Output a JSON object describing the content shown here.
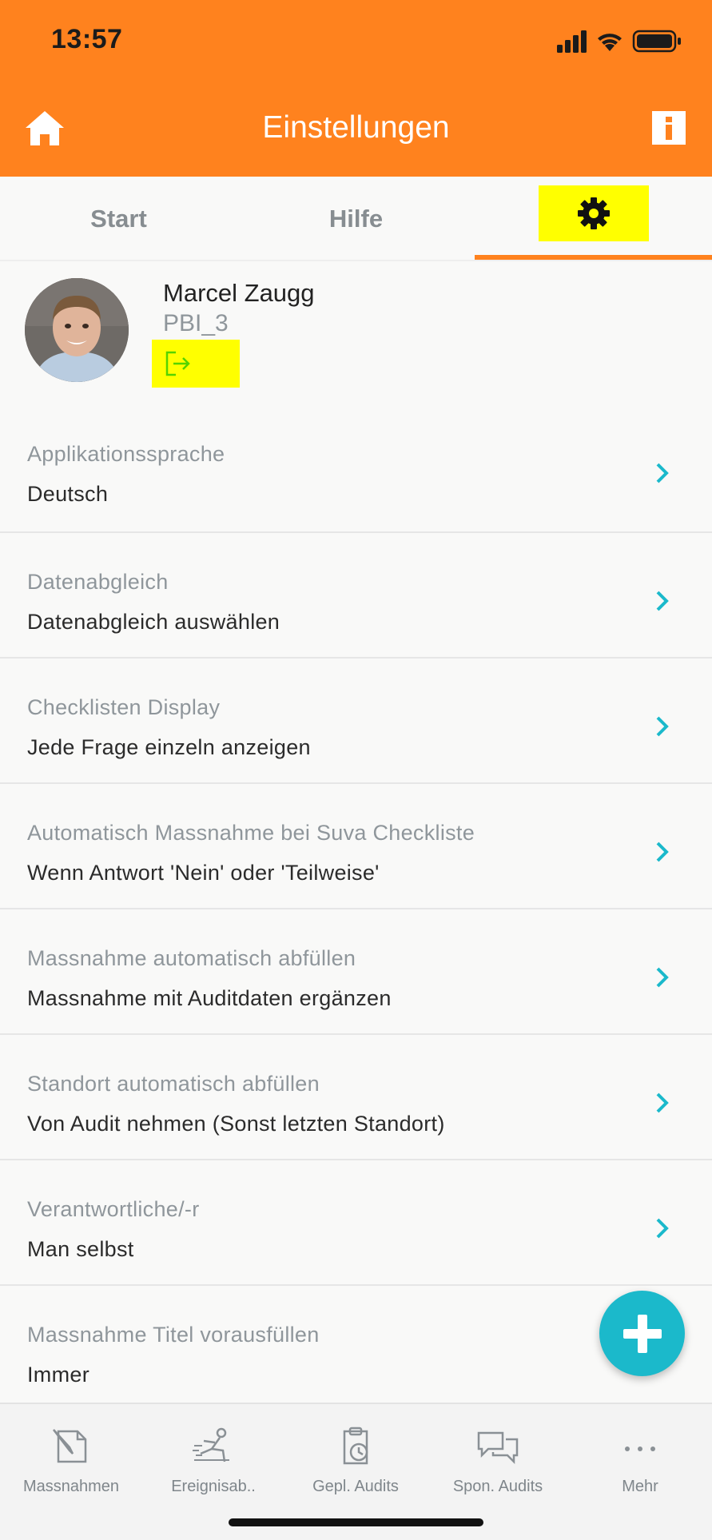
{
  "status_bar": {
    "time": "13:57"
  },
  "header": {
    "title": "Einstellungen",
    "home_icon": "home-icon",
    "info_icon": "info-icon"
  },
  "tabs": [
    {
      "label": "Start"
    },
    {
      "label": "Hilfe"
    },
    {
      "label": "",
      "icon": "gear-icon",
      "active": true
    }
  ],
  "profile": {
    "name": "Marcel Zaugg",
    "username": "PBI_3",
    "logout_icon": "logout-icon"
  },
  "settings": [
    {
      "label": "Applikationssprache",
      "value": "Deutsch"
    },
    {
      "label": "Datenabgleich",
      "value": "Datenabgleich auswählen"
    },
    {
      "label": "Checklisten Display",
      "value": "Jede Frage einzeln anzeigen"
    },
    {
      "label": "Automatisch Massnahme bei Suva Checkliste",
      "value": "Wenn Antwort 'Nein' oder 'Teilweise'"
    },
    {
      "label": "Massnahme automatisch abfüllen",
      "value": "Massnahme mit Auditdaten ergänzen"
    },
    {
      "label": "Standort automatisch abfüllen",
      "value": "Von Audit nehmen (Sonst letzten Standort)"
    },
    {
      "label": "Verantwortliche/-r",
      "value": "Man selbst"
    },
    {
      "label": "Massnahme Titel vorausfüllen",
      "value": "Immer"
    }
  ],
  "bottom_nav": [
    {
      "label": "Massnahmen",
      "icon": "measures-icon"
    },
    {
      "label": "Ereignisab..",
      "icon": "incident-icon"
    },
    {
      "label": "Gepl. Audits",
      "icon": "clipboard-clock-icon"
    },
    {
      "label": "Spon. Audits",
      "icon": "chat-bubbles-icon"
    },
    {
      "label": "Mehr",
      "icon": "more-icon"
    }
  ],
  "colors": {
    "accent": "#ff821e",
    "teal": "#1bb9cb",
    "highlight": "#ffff00"
  }
}
